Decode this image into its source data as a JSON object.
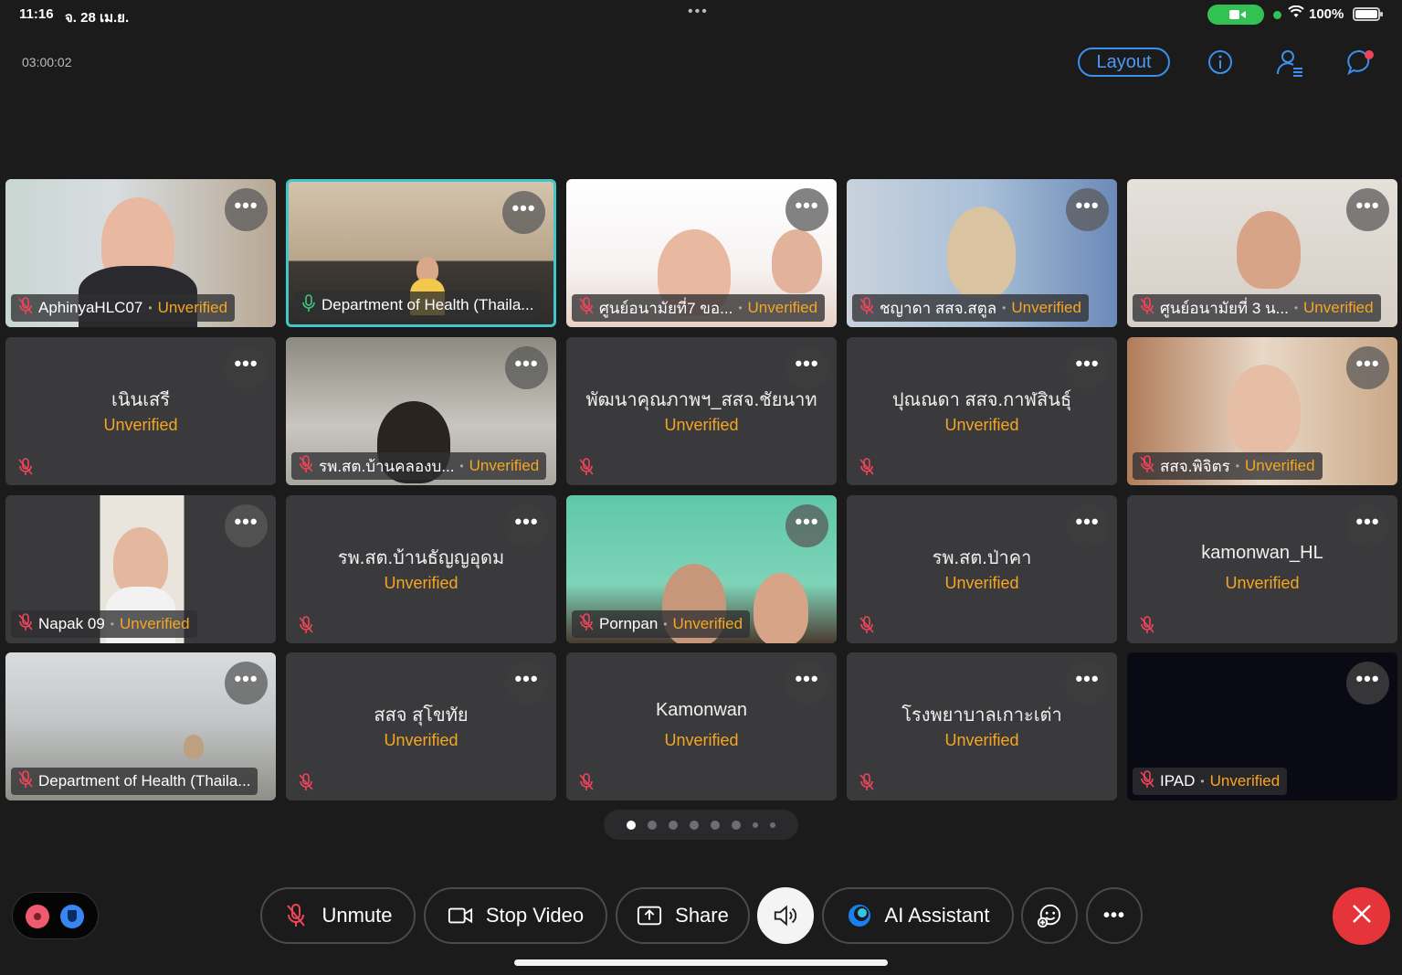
{
  "status_bar": {
    "time": "11:16",
    "date": "จ. 28 เม.ย.",
    "dots": "•••",
    "battery": "100%"
  },
  "meeting": {
    "timer": "03:00:02",
    "layout_label": "Layout"
  },
  "participants": [
    {
      "name": "AphinyaHLC07",
      "status": "Unverified",
      "view": "video",
      "muted": true
    },
    {
      "name": "Department of Health (Thaila...",
      "status": "",
      "view": "video",
      "muted": false,
      "active_speaker": true
    },
    {
      "name": "ศูนย์อนามัยที่7 ขอ...",
      "status": "Unverified",
      "view": "video",
      "muted": true
    },
    {
      "name": "ชญาดา สสจ.สตูล",
      "status": "Unverified",
      "view": "video",
      "muted": true
    },
    {
      "name": "ศูนย์อนามัยที่ 3 น...",
      "status": "Unverified",
      "view": "video",
      "muted": true
    },
    {
      "name": "เนินเสรี",
      "status": "Unverified",
      "view": "avatar",
      "muted": true
    },
    {
      "name": "รพ.สต.บ้านคลองบ...",
      "status": "Unverified",
      "view": "video",
      "muted": true
    },
    {
      "name": "พัฒนาคุณภาพฯ_สสจ.ชัยนาท",
      "status": "Unverified",
      "view": "avatar",
      "muted": true
    },
    {
      "name": "ปุณณดา สสจ.กาฬสินธุ์",
      "status": "Unverified",
      "view": "avatar",
      "muted": true
    },
    {
      "name": "สสจ.พิจิตร",
      "status": "Unverified",
      "view": "video",
      "muted": true
    },
    {
      "name": "Napak 09",
      "status": "Unverified",
      "view": "video",
      "muted": true
    },
    {
      "name": "รพ.สต.บ้านธัญญอุดม",
      "status": "Unverified",
      "view": "avatar",
      "muted": true
    },
    {
      "name": "Pornpan",
      "status": "Unverified",
      "view": "video",
      "muted": true
    },
    {
      "name": "รพ.สต.ป่าคา",
      "status": "Unverified",
      "view": "avatar",
      "muted": true
    },
    {
      "name": "kamonwan_HL",
      "status": "Unverified",
      "view": "avatar",
      "muted": true
    },
    {
      "name": "Department of Health (Thaila...",
      "status": "",
      "view": "video",
      "muted": true
    },
    {
      "name": "สสจ สุโขทัย",
      "status": "Unverified",
      "view": "avatar",
      "muted": true
    },
    {
      "name": "Kamonwan",
      "status": "Unverified",
      "view": "avatar",
      "muted": true
    },
    {
      "name": "โรงพยาบาลเกาะเต่า",
      "status": "Unverified",
      "view": "avatar",
      "muted": true
    },
    {
      "name": "IPAD",
      "status": "Unverified",
      "view": "dark",
      "muted": true
    }
  ],
  "tile_more_label": "•••",
  "pager": {
    "pages": 8,
    "current": 1
  },
  "controls": {
    "unmute": "Unmute",
    "stop_video": "Stop Video",
    "share": "Share",
    "ai_assistant": "AI Assistant",
    "more": "•••"
  },
  "colors": {
    "background": "#1b1b1c",
    "tile": "#3a3a3c",
    "unverified": "#f5a623",
    "accent_blue": "#3a8ff0",
    "active_border": "#3fc7c9",
    "leave_red": "#e5343a",
    "camera_green": "#31c253"
  },
  "icons": [
    "camera-icon",
    "wifi-icon",
    "battery-icon",
    "info-icon",
    "participants-icon",
    "chat-icon",
    "mic-muted-icon",
    "mic-icon",
    "video-icon",
    "share-icon",
    "speaker-icon",
    "ai-assistant-icon",
    "reaction-icon",
    "more-icon",
    "close-icon",
    "record-icon",
    "shield-icon"
  ]
}
